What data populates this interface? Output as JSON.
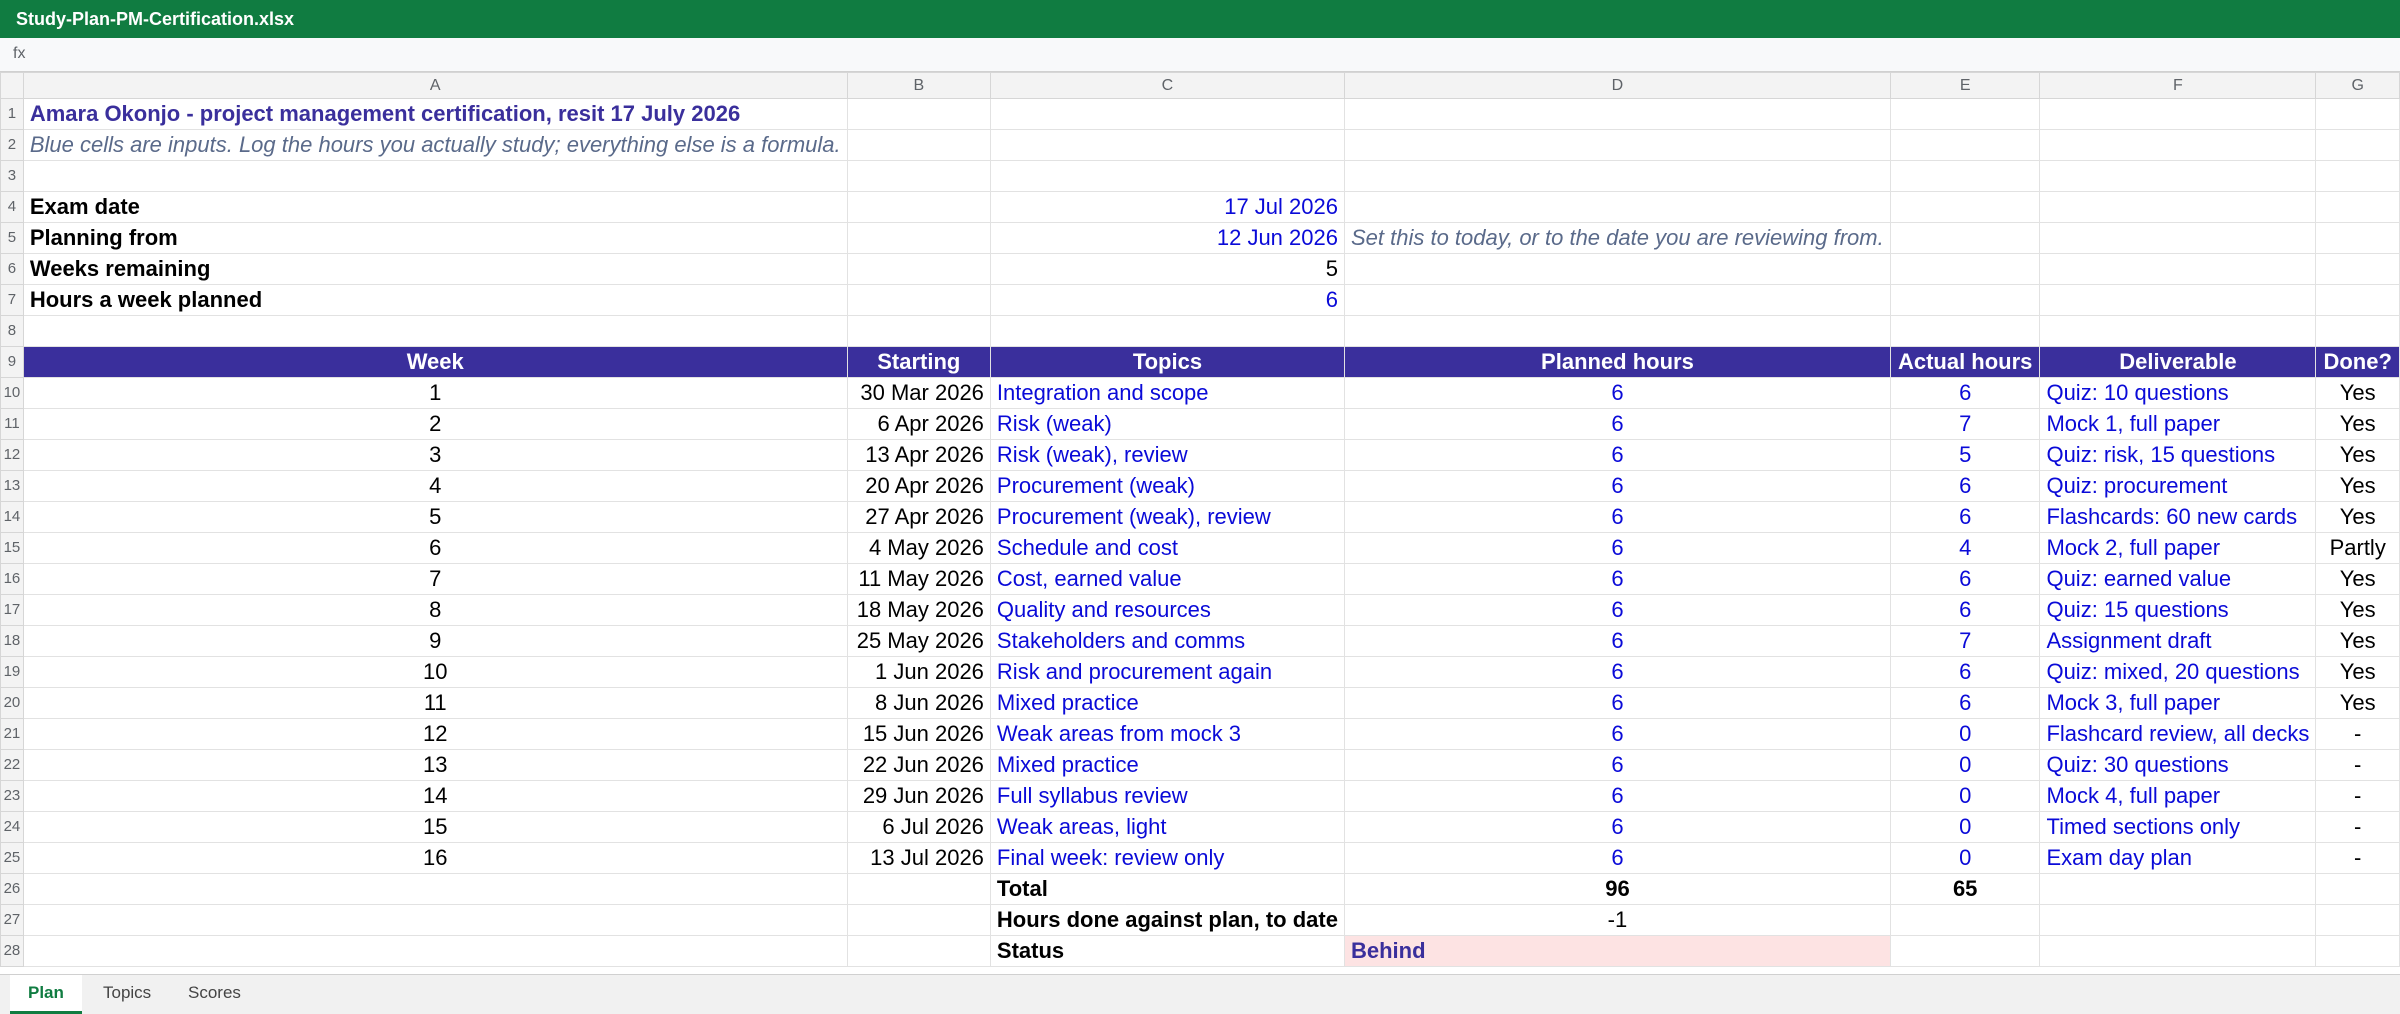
{
  "window": {
    "title": "Study-Plan-PM-Certification.xlsx"
  },
  "formula_bar": {
    "label": "fx",
    "value": ""
  },
  "columns": [
    "A",
    "B",
    "C",
    "D",
    "E",
    "F",
    "G"
  ],
  "rows": [
    "1",
    "2",
    "3",
    "4",
    "5",
    "6",
    "7",
    "8",
    "9",
    "10",
    "11",
    "12",
    "13",
    "14",
    "15",
    "16",
    "17",
    "18",
    "19",
    "20",
    "21",
    "22",
    "23",
    "24",
    "25",
    "26",
    "27",
    "28"
  ],
  "sheet": {
    "title": "Amara Okonjo - project management certification, resit 17 July 2026",
    "subtitle": "Blue cells are inputs. Log the hours you actually study; everything else is a formula.",
    "exam_date_label": "Exam date",
    "exam_date": "17 Jul 2026",
    "planning_from_label": "Planning from",
    "planning_from": "12 Jun 2026",
    "planning_note": "Set this to today, or to the date you are reviewing from.",
    "weeks_remaining_label": "Weeks remaining",
    "weeks_remaining": "5",
    "hours_week_label": "Hours a week planned",
    "hours_week": "6",
    "headers": [
      "Week",
      "Starting",
      "Topics",
      "Planned hours",
      "Actual hours",
      "Deliverable",
      "Done?"
    ],
    "weeks": [
      [
        "1",
        "30 Mar 2026",
        "Integration and scope",
        "6",
        "6",
        "Quiz: 10 questions",
        "Yes"
      ],
      [
        "2",
        "6 Apr 2026",
        "Risk (weak)",
        "6",
        "7",
        "Mock 1, full paper",
        "Yes"
      ],
      [
        "3",
        "13 Apr 2026",
        "Risk (weak), review",
        "6",
        "5",
        "Quiz: risk, 15 questions",
        "Yes"
      ],
      [
        "4",
        "20 Apr 2026",
        "Procurement (weak)",
        "6",
        "6",
        "Quiz: procurement",
        "Yes"
      ],
      [
        "5",
        "27 Apr 2026",
        "Procurement (weak), review",
        "6",
        "6",
        "Flashcards: 60 new cards",
        "Yes"
      ],
      [
        "6",
        "4 May 2026",
        "Schedule and cost",
        "6",
        "4",
        "Mock 2, full paper",
        "Partly"
      ],
      [
        "7",
        "11 May 2026",
        "Cost, earned value",
        "6",
        "6",
        "Quiz: earned value",
        "Yes"
      ],
      [
        "8",
        "18 May 2026",
        "Quality and resources",
        "6",
        "6",
        "Quiz: 15 questions",
        "Yes"
      ],
      [
        "9",
        "25 May 2026",
        "Stakeholders and comms",
        "6",
        "7",
        "Assignment draft",
        "Yes"
      ],
      [
        "10",
        "1 Jun 2026",
        "Risk and procurement again",
        "6",
        "6",
        "Quiz: mixed, 20 questions",
        "Yes"
      ],
      [
        "11",
        "8 Jun 2026",
        "Mixed practice",
        "6",
        "6",
        "Mock 3, full paper",
        "Yes"
      ],
      [
        "12",
        "15 Jun 2026",
        "Weak areas from mock 3",
        "6",
        "0",
        "Flashcard review, all decks",
        "-"
      ],
      [
        "13",
        "22 Jun 2026",
        "Mixed practice",
        "6",
        "0",
        "Quiz: 30 questions",
        "-"
      ],
      [
        "14",
        "29 Jun 2026",
        "Full syllabus review",
        "6",
        "0",
        "Mock 4, full paper",
        "-"
      ],
      [
        "15",
        "6 Jul 2026",
        "Weak areas, light",
        "6",
        "0",
        "Timed sections only",
        "-"
      ],
      [
        "16",
        "13 Jul 2026",
        "Final week: review only",
        "6",
        "0",
        "Exam day plan",
        "-"
      ]
    ],
    "total_label": "Total",
    "total_planned": "96",
    "total_actual": "65",
    "against_label": "Hours done against plan, to date",
    "against_value": "-1",
    "status_label": "Status",
    "status_value": "Behind"
  },
  "tabs": [
    {
      "label": "Plan",
      "active": true
    },
    {
      "label": "Topics",
      "active": false
    },
    {
      "label": "Scores",
      "active": false
    }
  ],
  "colors": {
    "titlebar": "#107c41",
    "header_fill": "#3a2f9c",
    "input_text": "#0a0ad8",
    "status_fill": "#fde3e3"
  }
}
